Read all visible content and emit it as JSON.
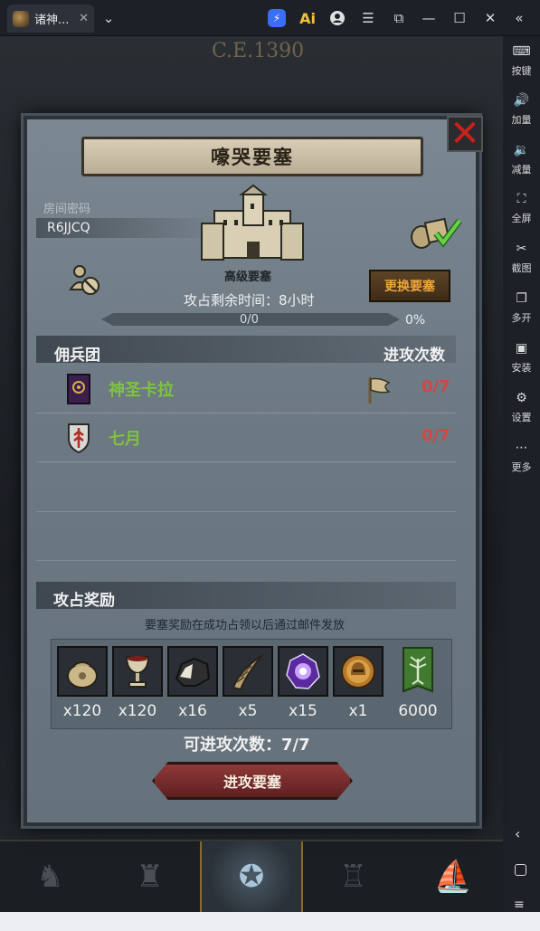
{
  "window": {
    "tab_title": "诸神...",
    "tab_close": "✕",
    "dropdown": "⌄",
    "ai_label": "Ai"
  },
  "sidebar": {
    "items": [
      {
        "label": "按键",
        "icon": "keyboard-icon",
        "glyph": "⌨"
      },
      {
        "label": "加量",
        "icon": "volume-up-icon",
        "glyph": "🔊"
      },
      {
        "label": "减量",
        "icon": "volume-down-icon",
        "glyph": "🔉"
      },
      {
        "label": "全屏",
        "icon": "fullscreen-icon",
        "glyph": "⛶"
      },
      {
        "label": "截图",
        "icon": "scissors-icon",
        "glyph": "✂"
      },
      {
        "label": "多开",
        "icon": "multi-instance-icon",
        "glyph": "❐"
      },
      {
        "label": "安装",
        "icon": "apk-install-icon",
        "glyph": "▣"
      },
      {
        "label": "设置",
        "icon": "settings-icon",
        "glyph": "⚙"
      },
      {
        "label": "更多",
        "icon": "more-icon",
        "glyph": "⋯"
      }
    ]
  },
  "game": {
    "era": "C.E.1390"
  },
  "modal": {
    "title": "嚎哭要塞",
    "room_label": "房间密码",
    "room_code": "R6JJCQ",
    "fortress_level": "高级要塞",
    "change_button": "更换要塞",
    "time_remaining": "攻占剩余时间：8小时",
    "progress_text": "0/0",
    "progress_pct": "0%",
    "progress_value": 0,
    "mercs_header": "佣兵团",
    "attacks_header": "进攻次数",
    "mercenaries": [
      {
        "name": "神圣卡拉",
        "count": "0/7"
      },
      {
        "name": "七月",
        "count": "0/7"
      }
    ],
    "rewards_header": "攻占奖励",
    "rewards_note": "要塞奖励在成功占领以后通过邮件发放",
    "rewards": [
      {
        "item": "coin-pouch-icon",
        "qty": "x120"
      },
      {
        "item": "chalice-icon",
        "qty": "x120"
      },
      {
        "item": "ore-chunk-icon",
        "qty": "x16"
      },
      {
        "item": "horn-icon",
        "qty": "x5"
      },
      {
        "item": "purple-crystal-icon",
        "qty": "x15"
      },
      {
        "item": "helmet-medal-icon",
        "qty": "x1"
      },
      {
        "item": "guild-banner-icon",
        "qty": "6000"
      }
    ],
    "attempts": "可进攻次数：7/7",
    "attack_button": "进攻要塞"
  },
  "colors": {
    "merc_name": "#7fc241",
    "count_red": "#d14745",
    "change_btn_text": "#f0a43a",
    "close_red": "#c9211a"
  }
}
